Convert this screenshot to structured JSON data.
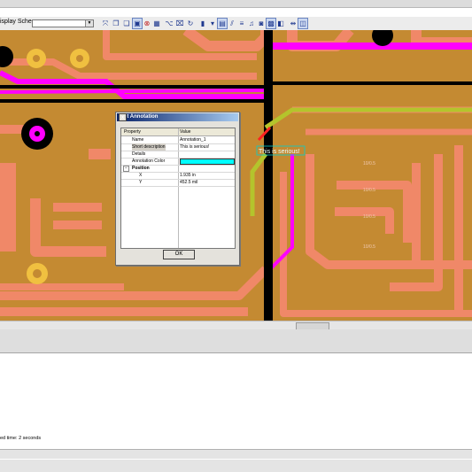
{
  "toolbar": {
    "display_scheme_label": "isplay Scheme",
    "display_scheme_value": ""
  },
  "board": {
    "annotation_text": "This is serious!",
    "net_labels": [
      "10/0.5",
      "10/0.5",
      "10/0.5",
      "10/0.5"
    ]
  },
  "dialog": {
    "title": "Edit Annotation",
    "close": "x",
    "columns": [
      "Property",
      "Value"
    ],
    "rows": [
      {
        "key": "Name",
        "value": "Annotation_1"
      },
      {
        "key": "Short description",
        "value": "This is serious!"
      },
      {
        "key": "Details",
        "value": ""
      },
      {
        "key": "Annotation Color",
        "value": ""
      },
      {
        "key": "Position",
        "value": ""
      },
      {
        "key": "X",
        "value": "1.935 in"
      },
      {
        "key": "Y",
        "value": "452.5 mil"
      }
    ],
    "ok": "OK",
    "annotation_color": "#00ffff"
  },
  "output": {
    "log_line": "ed time: 2 seconds"
  },
  "colors": {
    "board_bg": "#c48a32",
    "trace": "#f08868",
    "via_ring": "#f0c040",
    "magenta": "#ff00ff",
    "black_trace": "#000000",
    "yellow_green": "#b4c42c"
  }
}
